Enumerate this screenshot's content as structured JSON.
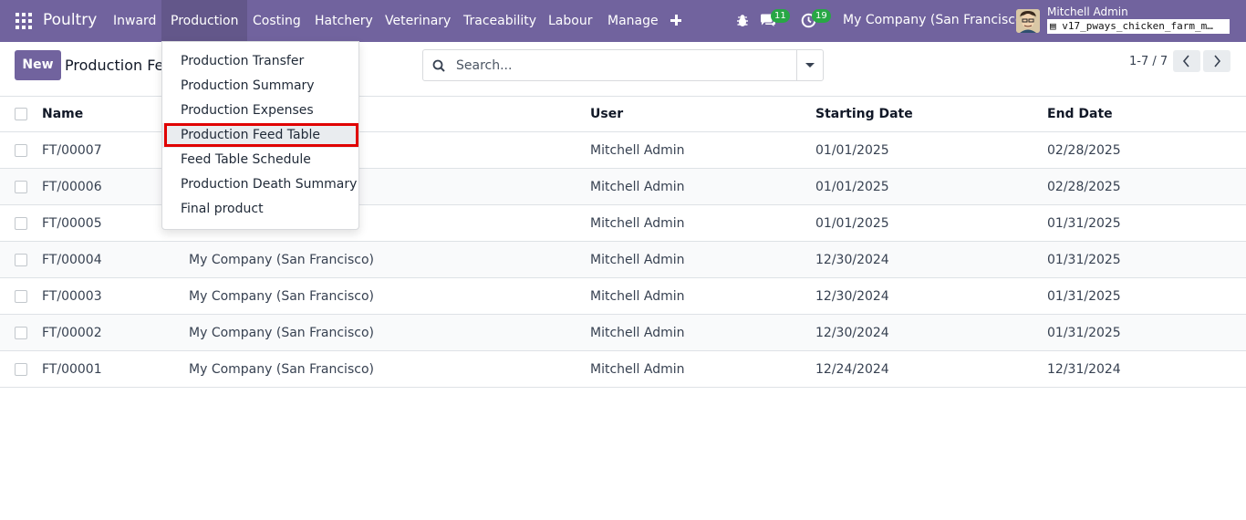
{
  "app": {
    "brand": "Poultry"
  },
  "nav": {
    "items": [
      {
        "label": "Inward"
      },
      {
        "label": "Production"
      },
      {
        "label": "Costing"
      },
      {
        "label": "Hatchery"
      },
      {
        "label": "Veterinary"
      },
      {
        "label": "Traceability"
      },
      {
        "label": "Labour"
      },
      {
        "label": "Manage"
      }
    ],
    "messages_badge": "11",
    "activities_badge": "19",
    "company": "My Company (San Francisco)",
    "user_name": "Mitchell Admin",
    "database": "v17_pways_chicken_farm_m…"
  },
  "control": {
    "new_label": "New",
    "page_title": "Production Fe",
    "search_placeholder": "Search...",
    "pager": "1-7 / 7"
  },
  "dropdown": {
    "items": [
      {
        "label": "Production Transfer"
      },
      {
        "label": "Production Summary"
      },
      {
        "label": "Production Expenses"
      },
      {
        "label": "Production Feed Table"
      },
      {
        "label": "Feed Table Schedule"
      },
      {
        "label": "Production Death Summary"
      },
      {
        "label": "Final product"
      }
    ]
  },
  "table": {
    "columns": {
      "name": "Name",
      "user": "User",
      "start": "Starting Date",
      "end": "End Date"
    },
    "rows": [
      {
        "name": "FT/00007",
        "company": "",
        "user": "Mitchell Admin",
        "start": "01/01/2025",
        "end": "02/28/2025"
      },
      {
        "name": "FT/00006",
        "company": "",
        "user": "Mitchell Admin",
        "start": "01/01/2025",
        "end": "02/28/2025"
      },
      {
        "name": "FT/00005",
        "company": "",
        "user": "Mitchell Admin",
        "start": "01/01/2025",
        "end": "01/31/2025"
      },
      {
        "name": "FT/00004",
        "company": "My Company (San Francisco)",
        "user": "Mitchell Admin",
        "start": "12/30/2024",
        "end": "01/31/2025"
      },
      {
        "name": "FT/00003",
        "company": "My Company (San Francisco)",
        "user": "Mitchell Admin",
        "start": "12/30/2024",
        "end": "01/31/2025"
      },
      {
        "name": "FT/00002",
        "company": "My Company (San Francisco)",
        "user": "Mitchell Admin",
        "start": "12/30/2024",
        "end": "01/31/2025"
      },
      {
        "name": "FT/00001",
        "company": "My Company (San Francisco)",
        "user": "Mitchell Admin",
        "start": "12/24/2024",
        "end": "12/31/2024"
      }
    ]
  },
  "colors": {
    "brand": "#71639e",
    "badge": "#28a745",
    "highlight_border": "#e00000"
  }
}
